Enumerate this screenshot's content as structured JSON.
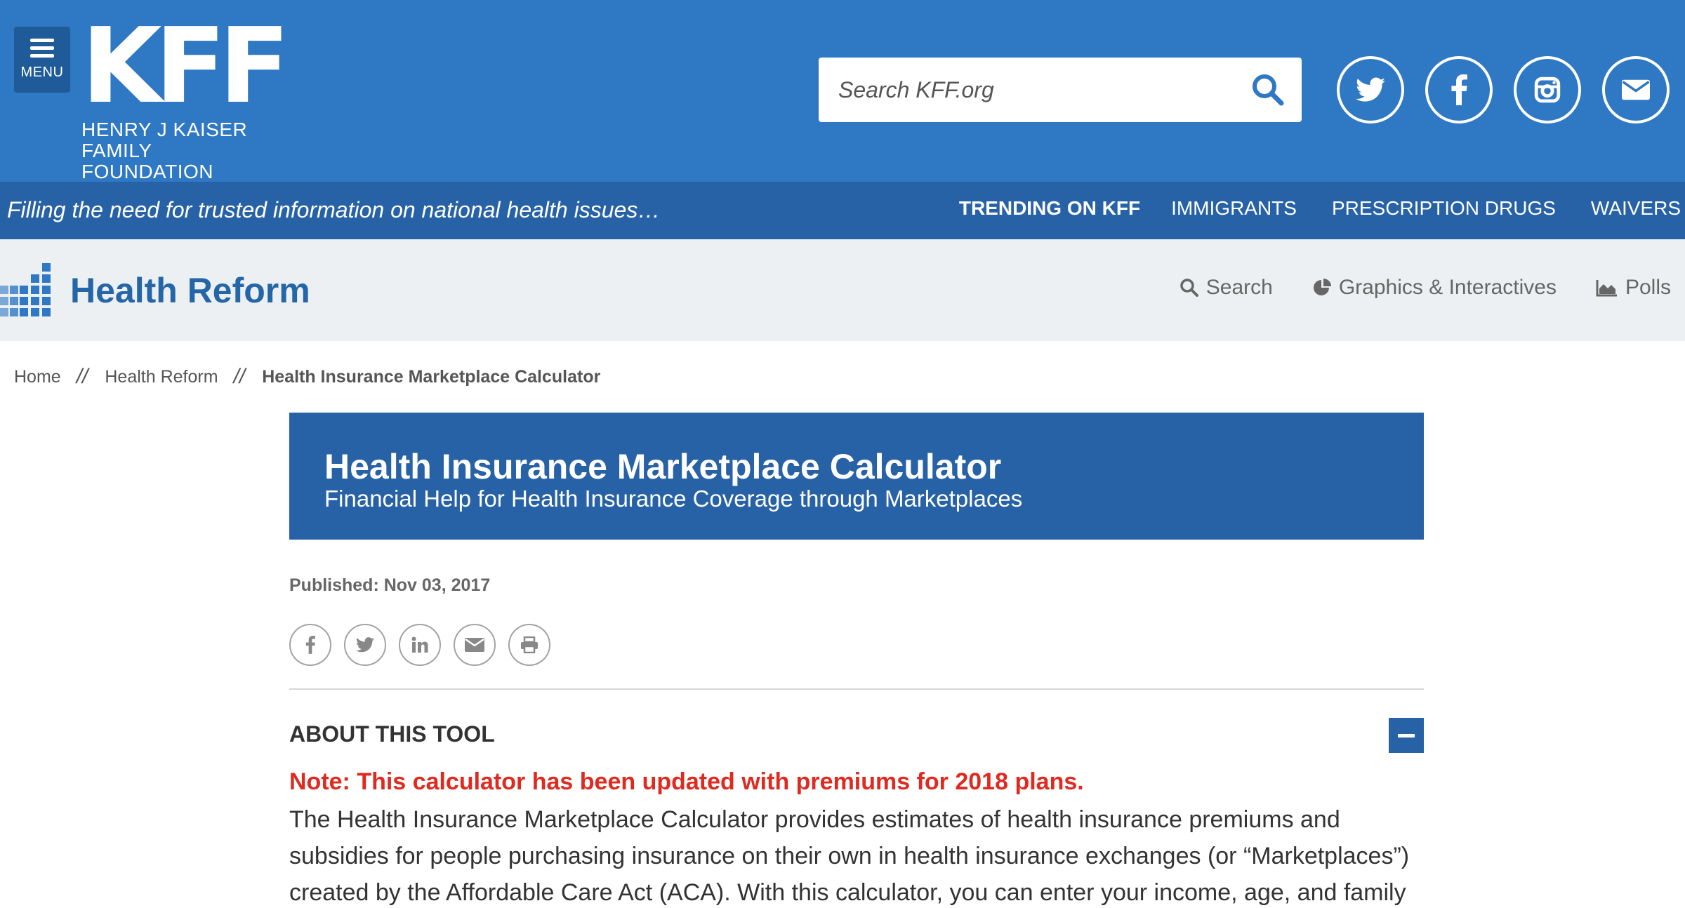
{
  "header": {
    "menu_label": "MENU",
    "logo_mark": "KFF",
    "logo_line1": "HENRY J KAISER",
    "logo_line2": "FAMILY FOUNDATION",
    "search_placeholder": "Search KFF.org",
    "social_icons": [
      "twitter-icon",
      "facebook-icon",
      "instagram-icon",
      "email-icon"
    ],
    "brand_color": "#2f78c4"
  },
  "tagline_bar": {
    "tagline": "Filling the need for trusted information on national health issues…",
    "trending_title": "TRENDING ON KFF",
    "trending_items": [
      "IMMIGRANTS",
      "PRESCRIPTION DRUGS",
      "WAIVERS"
    ]
  },
  "section": {
    "title": "Health Reform",
    "nav": [
      {
        "label": "Search",
        "icon": "search-icon"
      },
      {
        "label": "Graphics & Interactives",
        "icon": "pie-chart-icon"
      },
      {
        "label": "Polls",
        "icon": "area-chart-icon"
      }
    ]
  },
  "breadcrumb": {
    "items": [
      "Home",
      "Health Reform",
      "Health Insurance Marketplace Calculator"
    ],
    "separator": "//"
  },
  "banner": {
    "title": "Health Insurance Marketplace Calculator",
    "subtitle": "Financial Help for Health Insurance Coverage through Marketplaces"
  },
  "published": "Published: Nov 03, 2017",
  "share_icons": [
    "facebook-icon",
    "twitter-icon",
    "linkedin-icon",
    "email-icon",
    "print-icon"
  ],
  "about": {
    "heading": "ABOUT THIS TOOL",
    "note": "Note: This calculator has been updated with premiums for 2018 plans.",
    "intro": "The Health Insurance Marketplace Calculator provides estimates of health insurance premiums and subsidies for people purchasing insurance on their own in health insurance exchanges (or “Marketplaces”) created by the Affordable Care Act (ACA). With this calculator, you can enter your income, age, and family"
  }
}
